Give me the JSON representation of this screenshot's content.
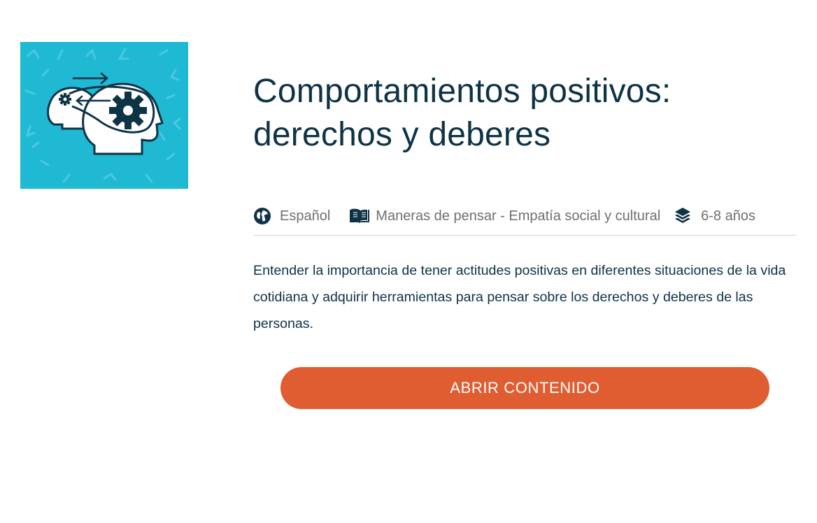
{
  "thumbnail": {
    "icon": "heads-with-gears-icon",
    "background_color": "#1fb9d4"
  },
  "course": {
    "title_line1": "Comportamientos positivos:",
    "title_line2": "derechos y deberes",
    "description": "Entender la importancia de tener actitudes positivas en diferentes situaciones de la vida cotidiana y adquirir herramientas para pensar sobre los derechos y deberes de las personas."
  },
  "meta": {
    "language": {
      "icon": "globe-icon",
      "label": "Español"
    },
    "topic": {
      "icon": "open-book-icon",
      "label": "Maneras de pensar - Empatía social y cultural"
    },
    "age": {
      "icon": "layers-icon",
      "label": "6-8 años"
    }
  },
  "actions": {
    "open_label": "ABRIR CONTENIDO"
  },
  "colors": {
    "title": "#0e3346",
    "meta_text": "#6f6f6f",
    "button": "#e05d32"
  }
}
